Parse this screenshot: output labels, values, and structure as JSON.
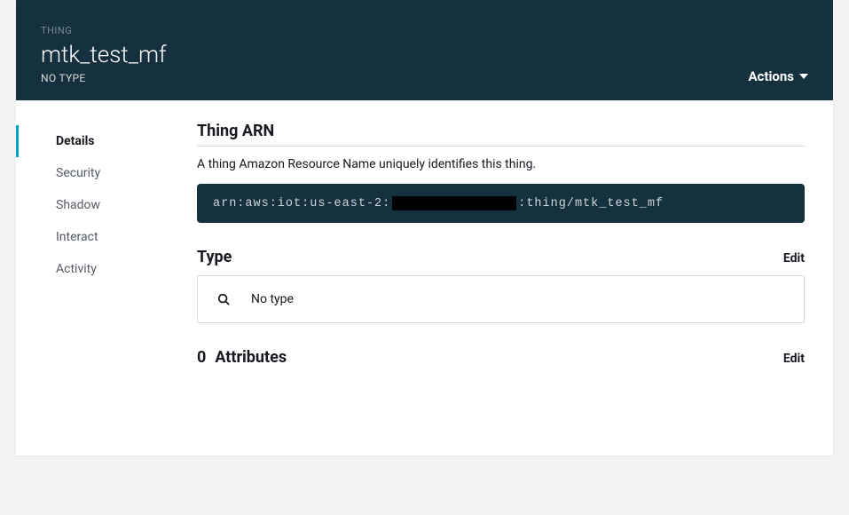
{
  "header": {
    "eyebrow": "THING",
    "title": "mtk_test_mf",
    "subtitle": "NO TYPE",
    "actions_label": "Actions"
  },
  "sidebar": {
    "items": [
      {
        "label": "Details",
        "active": true
      },
      {
        "label": "Security",
        "active": false
      },
      {
        "label": "Shadow",
        "active": false
      },
      {
        "label": "Interact",
        "active": false
      },
      {
        "label": "Activity",
        "active": false
      }
    ]
  },
  "arn_section": {
    "heading": "Thing ARN",
    "description": "A thing Amazon Resource Name uniquely identifies this thing.",
    "arn_prefix": "arn:aws:iot:us-east-2:",
    "arn_suffix": ":thing/mtk_test_mf"
  },
  "type_section": {
    "heading": "Type",
    "edit_label": "Edit",
    "value": "No type"
  },
  "attributes_section": {
    "count": "0",
    "heading": "Attributes",
    "edit_label": "Edit"
  }
}
